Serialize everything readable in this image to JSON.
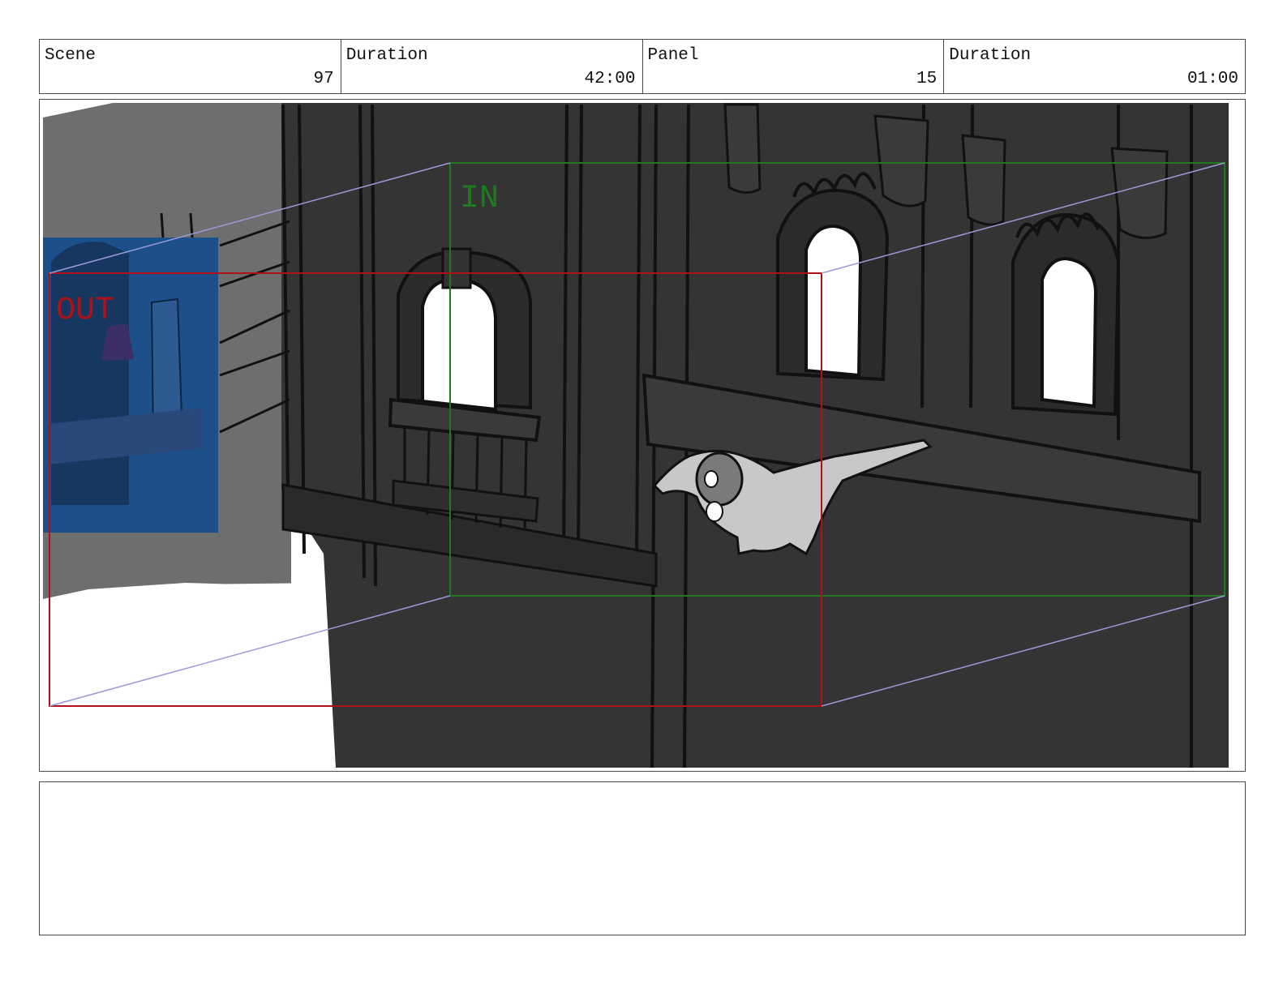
{
  "header": {
    "scene_label": "Scene",
    "scene_value": "97",
    "scene_duration_label": "Duration",
    "scene_duration_value": "42:00",
    "panel_label": "Panel",
    "panel_value": "15",
    "panel_duration_label": "Duration",
    "panel_duration_value": "01:00"
  },
  "frame": {
    "in_label": "IN",
    "out_label": "OUT",
    "in_color": "#1f7a1f",
    "out_color": "#b0101a",
    "motion_arrow_color": "#9a9ad8"
  },
  "notes": {
    "text": ""
  }
}
